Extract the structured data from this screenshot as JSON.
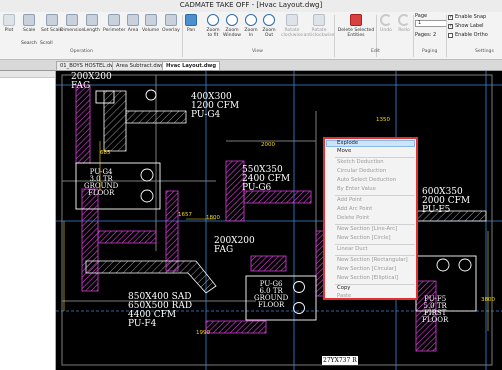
{
  "window": {
    "title": "CADMATE TAKE OFF - [Hvac Layout.dwg]"
  },
  "ribbon": {
    "buttons": [
      {
        "label": "Plot",
        "icon": "printer-icon"
      },
      {
        "label": "Scale",
        "icon": "scale-icon"
      },
      {
        "label": "Set Scale",
        "icon": "set-scale-icon"
      },
      {
        "label": "Dimension",
        "icon": "dimension-icon"
      },
      {
        "label": "Length",
        "icon": "length-icon"
      },
      {
        "label": "Perimeter",
        "icon": "perimeter-icon"
      },
      {
        "label": "Area",
        "icon": "area-icon"
      },
      {
        "label": "Volume",
        "icon": "volume-icon"
      },
      {
        "label": "Overlay",
        "icon": "overlay-icon"
      },
      {
        "label": "Pan",
        "icon": "pan-icon"
      },
      {
        "label": "Zoom to fit",
        "icon": "zoom-fit-icon"
      },
      {
        "label": "Zoom Window",
        "icon": "zoom-window-icon"
      },
      {
        "label": "Zoom In",
        "icon": "zoom-in-icon"
      },
      {
        "label": "Zoom Out",
        "icon": "zoom-out-icon"
      },
      {
        "label": "Rotate clockwise",
        "icon": "rotate-cw-icon"
      },
      {
        "label": "Rotate anticlockwise",
        "icon": "rotate-ccw-icon"
      },
      {
        "label": "Delete Selected Entities",
        "icon": "delete-icon"
      },
      {
        "label": "Undo",
        "icon": "undo-icon"
      },
      {
        "label": "Redo",
        "icon": "redo-icon"
      }
    ],
    "search_label": "Search",
    "scroll_label": "Scroll",
    "groups": [
      "Operation",
      "View",
      "Edit",
      "Paging",
      "Settings"
    ],
    "paging": {
      "page_label": "Page",
      "page_value": "1",
      "pages_label": "Pages: 2"
    },
    "settings": [
      {
        "label": "Enable Snap",
        "checked": true
      },
      {
        "label": "Show Label",
        "checked": true
      },
      {
        "label": "Enable Ortho",
        "checked": false
      }
    ]
  },
  "tabs": [
    {
      "label": "01_BOYS HOSTEL.dwg",
      "active": false
    },
    {
      "label": "Area Subtract.dwg",
      "active": false
    },
    {
      "label": "Hvac Layout.dwg",
      "active": true
    }
  ],
  "drawing": {
    "colors": {
      "duct": "#ffffff",
      "hatch": "#e040e0",
      "dim": "#f5d916",
      "grid": "#3a8ad8"
    },
    "labels": {
      "fag1_top": "200X200",
      "fag1_bottom": "FAG",
      "pug4_duct_1": "400X300",
      "pug4_duct_2": "1200 CFM",
      "pug4_duct_3": "PU-G4",
      "pug4_ahu_1": "PU-G4",
      "pug4_ahu_2": "3.0 TR",
      "pug4_ahu_3": "GROUND",
      "pug4_ahu_4": "FLOOR",
      "pug6_duct_1": "550X350",
      "pug6_duct_2": "2400 CFM",
      "pug6_duct_3": "PU-G6",
      "fag2_top": "200X200",
      "fag2_bottom": "FAG",
      "puf4_1": "850X400 SAD",
      "puf4_2": "650X500 RAD",
      "puf4_3": "4400 CFM",
      "puf4_4": "PU-F4",
      "pug6_ahu_1": "PU-G6",
      "pug6_ahu_2": "6.0 TR",
      "pug6_ahu_3": "GROUND",
      "pug6_ahu_4": "FLOOR",
      "puf5_duct_1": "600X350",
      "puf5_duct_2": "2000 CFM",
      "puf5_duct_3": "PU-F5",
      "puf5_ahu_1": "PU-F5",
      "puf5_ahu_2": "5.0 TR",
      "puf5_ahu_3": "FIRST",
      "puf5_ahu_4": "FLOOR",
      "tag": "27YX737 R",
      "dims": [
        "2000",
        "685",
        "1657",
        "1800",
        "1990",
        "1350",
        "3800"
      ]
    }
  },
  "context_menu": {
    "items": [
      {
        "label": "Explode",
        "enabled": true,
        "highlighted": true
      },
      {
        "label": "Move",
        "enabled": true
      },
      {
        "label": "Sketch Deduction",
        "enabled": false
      },
      {
        "label": "Circular Deduction",
        "enabled": false
      },
      {
        "label": "Auto Select Deduction",
        "enabled": false
      },
      {
        "label": "By Enter Value",
        "enabled": false
      },
      {
        "label": "Add Point",
        "enabled": false
      },
      {
        "label": "Add Arc Point",
        "enabled": false
      },
      {
        "label": "Delete Point",
        "enabled": false
      },
      {
        "label": "New Section [Line-Arc]",
        "enabled": false
      },
      {
        "label": "New Section [Circle]",
        "enabled": false
      },
      {
        "label": "Linear Duct",
        "enabled": false
      },
      {
        "label": "New Section [Rectangular]",
        "enabled": false
      },
      {
        "label": "New Section [Circular]",
        "enabled": false
      },
      {
        "label": "New Section [Elliptical]",
        "enabled": false
      },
      {
        "label": "Copy",
        "enabled": true
      },
      {
        "label": "Paste",
        "enabled": false
      }
    ]
  }
}
